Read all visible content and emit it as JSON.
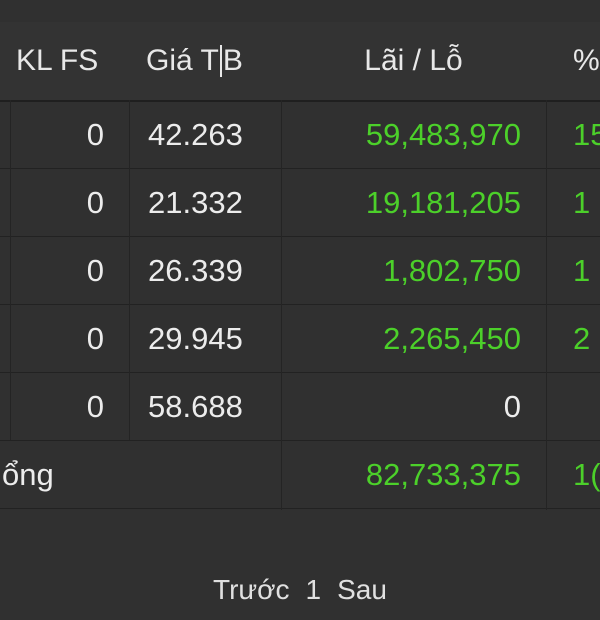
{
  "header": {
    "kl_fs": "KL FS",
    "gia_tb_a": "Giá T",
    "gia_tb_b": "B",
    "lai_lo": "Lãi / Lỗ",
    "pct": "%"
  },
  "rows": [
    {
      "kl_fs": "0",
      "gia_tb": "42.263",
      "lai_lo": "59,483,970",
      "pct": "15"
    },
    {
      "kl_fs": "0",
      "gia_tb": "21.332",
      "lai_lo": "19,181,205",
      "pct": "1"
    },
    {
      "kl_fs": "0",
      "gia_tb": "26.339",
      "lai_lo": "1,802,750",
      "pct": "1"
    },
    {
      "kl_fs": "0",
      "gia_tb": "29.945",
      "lai_lo": "2,265,450",
      "pct": "2"
    },
    {
      "kl_fs": "0",
      "gia_tb": "58.688",
      "lai_lo": "0",
      "pct": ""
    }
  ],
  "total": {
    "label": "ổng",
    "lai_lo": "82,733,375",
    "pct": "1("
  },
  "pager": {
    "prev": "Trước",
    "page": "1",
    "next": "Sau"
  },
  "colors": {
    "profit": "#4cd02a",
    "background": "#303030",
    "text": "#ececec"
  }
}
